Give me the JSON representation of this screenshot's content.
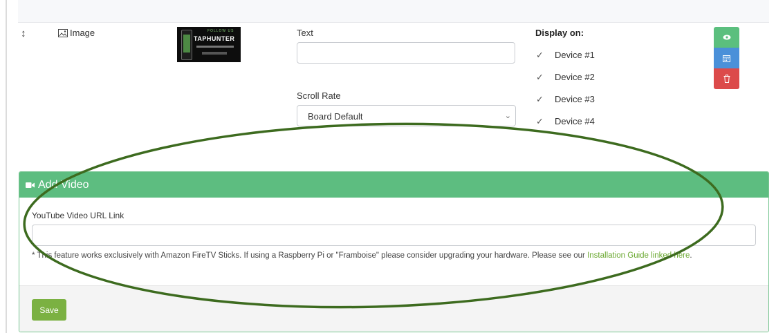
{
  "row": {
    "handle_icon": "↕",
    "media_type_icon": "image-icon",
    "media_type_label": "Image",
    "thumbnail": {
      "follow": "FOLLOW US",
      "brand": "TAPHUNTER"
    },
    "text_label": "Text",
    "text_value": "",
    "scroll_label": "Scroll Rate",
    "scroll_value": "Board Default",
    "display_title": "Display on:",
    "devices": [
      {
        "label": "Device #1",
        "checked": true
      },
      {
        "label": "Device #2",
        "checked": true
      },
      {
        "label": "Device #3",
        "checked": true
      },
      {
        "label": "Device #4",
        "checked": true
      }
    ],
    "actions": [
      "eye-icon",
      "calendar-icon",
      "trash-icon"
    ]
  },
  "video_panel": {
    "title": "Add Video",
    "icon": "video-camera-icon",
    "url_label": "YouTube Video URL Link",
    "url_value": "",
    "note_prefix": "* This feature works exclusively with Amazon FireTV Sticks. If using a Raspberry Pi or \"Framboise\" please consider upgrading your hardware. Please see our ",
    "note_link": "Installation Guide linked here",
    "note_suffix": ".",
    "save_label": "Save"
  },
  "colors": {
    "panel_header": "#5dbd80",
    "save_button": "#7bb142",
    "view_button": "#5bbf7e",
    "calendar_button": "#4a90d9",
    "delete_button": "#dc4a4a",
    "annotation_ellipse": "#3d6b1f",
    "link": "#6aa830"
  }
}
